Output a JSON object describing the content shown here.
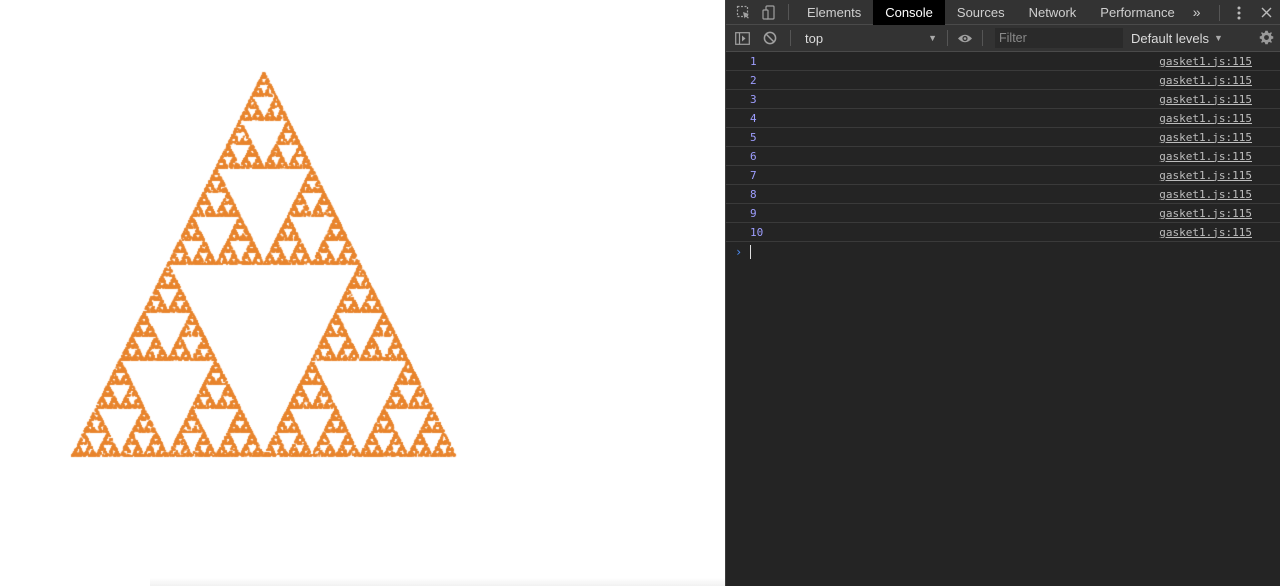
{
  "devtools": {
    "tabs": [
      {
        "label": "Elements",
        "active": false
      },
      {
        "label": "Console",
        "active": true
      },
      {
        "label": "Sources",
        "active": false
      },
      {
        "label": "Network",
        "active": false
      },
      {
        "label": "Performance",
        "active": false
      }
    ],
    "overflow_label": "»",
    "toolbar": {
      "context": "top",
      "filter_placeholder": "Filter",
      "levels_label": "Default levels"
    },
    "console_messages": [
      {
        "value": "1",
        "source": "gasket1.js:115"
      },
      {
        "value": "2",
        "source": "gasket1.js:115"
      },
      {
        "value": "3",
        "source": "gasket1.js:115"
      },
      {
        "value": "4",
        "source": "gasket1.js:115"
      },
      {
        "value": "5",
        "source": "gasket1.js:115"
      },
      {
        "value": "6",
        "source": "gasket1.js:115"
      },
      {
        "value": "7",
        "source": "gasket1.js:115"
      },
      {
        "value": "8",
        "source": "gasket1.js:115"
      },
      {
        "value": "9",
        "source": "gasket1.js:115"
      },
      {
        "value": "10",
        "source": "gasket1.js:115"
      }
    ],
    "prompt_symbol": "›"
  },
  "colors": {
    "gasket": "#e8852e",
    "console_value": "#9e9eff",
    "devtools_bg": "#242424"
  }
}
